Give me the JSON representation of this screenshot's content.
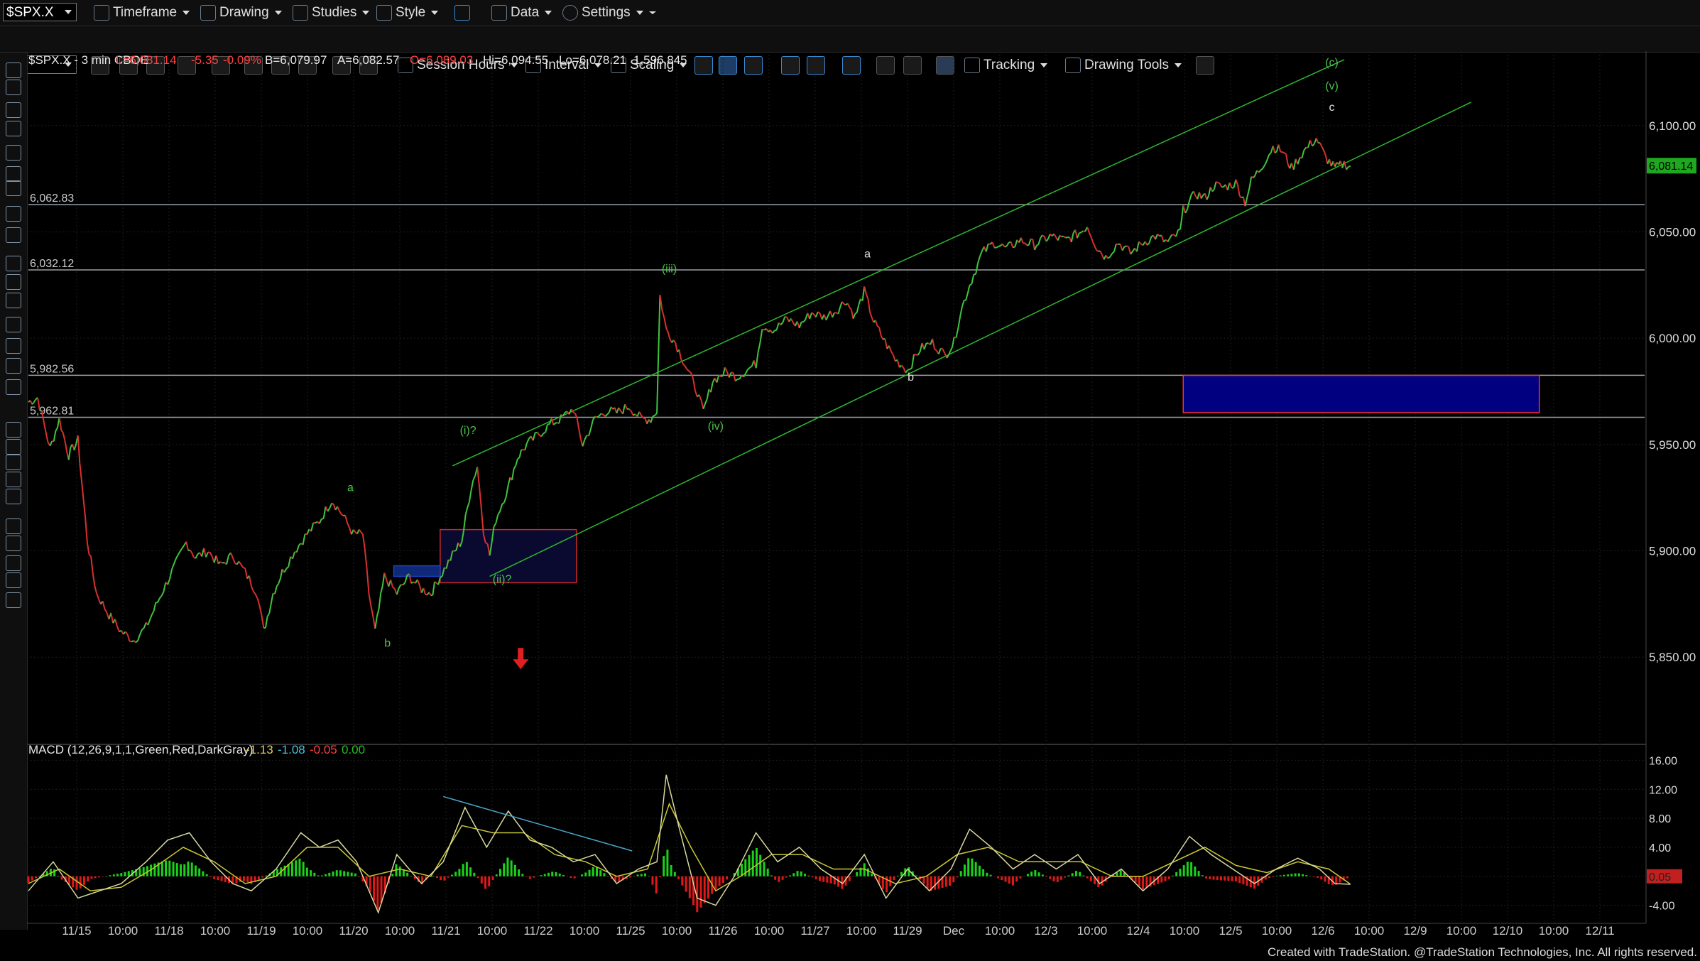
{
  "toolbar": {
    "symbol": "$SPX.X",
    "menus": [
      {
        "label": "Timeframe",
        "icon": "timeframe-icon"
      },
      {
        "label": "Drawing",
        "icon": "drawing-icon"
      },
      {
        "label": "Studies",
        "icon": "studies-icon"
      },
      {
        "label": "Style",
        "icon": "style-icon"
      },
      {
        "label": "Data",
        "icon": "data-icon"
      },
      {
        "label": "Settings",
        "icon": "gear-icon"
      }
    ],
    "row2": [
      {
        "label": "Session Hours",
        "icon": "session-hours-icon"
      },
      {
        "label": "Interval",
        "icon": "interval-icon"
      },
      {
        "label": "Scaling",
        "icon": "scaling-icon"
      },
      {
        "label": "Tracking",
        "icon": "tracking-icon"
      },
      {
        "label": "Drawing Tools",
        "icon": "drawing-tools-icon"
      }
    ]
  },
  "left_tools": [
    "cursor-icon",
    "crosshair-icon",
    "pen-icon",
    "brush-icon",
    "arrows-h-icon",
    "fib-icon",
    "channel-icon",
    "cycle-icon",
    "pencil-icon",
    "bars-icon",
    "pitchfork-icon",
    "lines-icon",
    "gann-icon",
    "dots-icon",
    "speedline-icon",
    "arc-icon",
    "arrow-down-icon",
    "arrow-up-icon",
    "ellipse-icon",
    "rectangle-icon",
    "text-icon",
    "line-icon",
    "eraser-icon",
    "ruler-icon",
    "highlighter-icon",
    "text-box-icon"
  ],
  "header": {
    "symbol_desc": "$SPX.X - 3 min  CBOE",
    "last": "L=6,081.14",
    "chg": "-5.35",
    "pct": "-0.09%",
    "bid": "B=6,079.97",
    "ask": "A=6,082.57",
    "open": "O=6,089.03",
    "hi": "Hi=6,094.55",
    "lo": "Lo=6,078.21",
    "vol": "1,596,845"
  },
  "macd_header": {
    "name": "MACD (12,26,9,1,1,Green,Red,DarkGray)",
    "v1": "-1.13",
    "v2": "-1.08",
    "v3": "-0.05",
    "v4": "0.00"
  },
  "footer": "Created with TradeStation. @TradeStation Technologies, Inc. All rights reserved.",
  "chart_data": {
    "type": "line",
    "ylim": [
      5810,
      6135
    ],
    "price_ticks": [
      "6,100.00",
      "6,050.00",
      "6,000.00",
      "5,950.00",
      "5,900.00",
      "5,850.00"
    ],
    "price_tick_values": [
      6100,
      6050,
      6000,
      5950,
      5900,
      5850
    ],
    "last_price_label": "6,081.14",
    "last_price": 6081.14,
    "horizontal_levels": [
      {
        "label": "6,062.83",
        "value": 6062.83
      },
      {
        "label": "6,032.12",
        "value": 6032.12
      },
      {
        "label": "5,982.56",
        "value": 5982.56
      },
      {
        "label": "5,962.81",
        "value": 5962.81
      }
    ],
    "x_tick_labels": [
      "11/15",
      "10:00",
      "11/18",
      "10:00",
      "11/19",
      "10:00",
      "11/20",
      "10:00",
      "11/21",
      "10:00",
      "11/22",
      "10:00",
      "11/25",
      "10:00",
      "11/26",
      "10:00",
      "11/27",
      "10:00",
      "11/29",
      "Dec",
      "10:00",
      "12/3",
      "10:00",
      "12/4",
      "10:00",
      "12/5",
      "10:00",
      "12/6",
      "10:00",
      "12/9",
      "10:00",
      "12/10",
      "10:00",
      "12/11"
    ],
    "price_path": [
      [
        0,
        5970
      ],
      [
        0.3,
        5972
      ],
      [
        0.5,
        5960
      ],
      [
        0.7,
        5948
      ],
      [
        1,
        5962
      ],
      [
        1.3,
        5945
      ],
      [
        1.6,
        5952
      ],
      [
        1.9,
        5905
      ],
      [
        2.2,
        5880
      ],
      [
        2.6,
        5870
      ],
      [
        3,
        5862
      ],
      [
        3.4,
        5858
      ],
      [
        3.8,
        5864
      ],
      [
        4.3,
        5880
      ],
      [
        4.7,
        5892
      ],
      [
        5.1,
        5904
      ],
      [
        5.4,
        5897
      ],
      [
        5.8,
        5900
      ],
      [
        6.2,
        5893
      ],
      [
        6.6,
        5898
      ],
      [
        7,
        5890
      ],
      [
        7.4,
        5880
      ],
      [
        7.6,
        5862
      ],
      [
        7.9,
        5880
      ],
      [
        8.2,
        5890
      ],
      [
        8.6,
        5900
      ],
      [
        9,
        5908
      ],
      [
        9.4,
        5914
      ],
      [
        9.8,
        5924
      ],
      [
        10.1,
        5918
      ],
      [
        10.5,
        5908
      ],
      [
        10.8,
        5908
      ],
      [
        11,
        5880
      ],
      [
        11.2,
        5862
      ],
      [
        11.5,
        5888
      ],
      [
        11.9,
        5880
      ],
      [
        12.3,
        5888
      ],
      [
        12.7,
        5882
      ],
      [
        13,
        5880
      ],
      [
        13.3,
        5888
      ],
      [
        13.7,
        5898
      ],
      [
        14,
        5905
      ],
      [
        14.3,
        5930
      ],
      [
        14.5,
        5940
      ],
      [
        14.7,
        5910
      ],
      [
        14.9,
        5898
      ],
      [
        15.1,
        5915
      ],
      [
        15.5,
        5930
      ],
      [
        15.8,
        5944
      ],
      [
        16.1,
        5950
      ],
      [
        16.5,
        5955
      ],
      [
        16.9,
        5960
      ],
      [
        17.2,
        5962
      ],
      [
        17.6,
        5967
      ],
      [
        17.9,
        5950
      ],
      [
        18.3,
        5962
      ],
      [
        18.7,
        5966
      ],
      [
        19,
        5965
      ],
      [
        19.4,
        5968
      ],
      [
        19.8,
        5962
      ],
      [
        20.1,
        5962
      ],
      [
        20.3,
        5966
      ],
      [
        20.4,
        6020
      ],
      [
        20.6,
        6004
      ],
      [
        20.9,
        5998
      ],
      [
        21.2,
        5988
      ],
      [
        21.6,
        5975
      ],
      [
        21.8,
        5965
      ],
      [
        22.1,
        5980
      ],
      [
        22.5,
        5984
      ],
      [
        22.9,
        5982
      ],
      [
        23.3,
        5986
      ],
      [
        23.5,
        5988
      ],
      [
        23.7,
        6006
      ],
      [
        24.1,
        6004
      ],
      [
        24.5,
        6009
      ],
      [
        24.9,
        6006
      ],
      [
        25.3,
        6012
      ],
      [
        25.7,
        6010
      ],
      [
        26.1,
        6013
      ],
      [
        26.4,
        6018
      ],
      [
        26.7,
        6010
      ],
      [
        27,
        6022
      ],
      [
        27.3,
        6008
      ],
      [
        27.6,
        6000
      ],
      [
        28,
        5990
      ],
      [
        28.4,
        5985
      ],
      [
        28.8,
        5995
      ],
      [
        29.2,
        5998
      ],
      [
        29.6,
        5992
      ],
      [
        29.9,
        5998
      ],
      [
        30.1,
        6012
      ],
      [
        30.4,
        6025
      ],
      [
        30.8,
        6040
      ],
      [
        31.2,
        6045
      ],
      [
        31.6,
        6042
      ],
      [
        32,
        6046
      ],
      [
        32.5,
        6044
      ],
      [
        33,
        6048
      ],
      [
        33.5,
        6046
      ],
      [
        34,
        6050
      ],
      [
        34.2,
        6053
      ],
      [
        34.5,
        6043
      ],
      [
        34.8,
        6038
      ],
      [
        35.2,
        6045
      ],
      [
        35.6,
        6040
      ],
      [
        36,
        6045
      ],
      [
        36.4,
        6048
      ],
      [
        36.8,
        6045
      ],
      [
        37.2,
        6050
      ],
      [
        37.3,
        6060
      ],
      [
        37.7,
        6068
      ],
      [
        38,
        6066
      ],
      [
        38.3,
        6072
      ],
      [
        38.6,
        6071
      ],
      [
        39,
        6073
      ],
      [
        39.3,
        6064
      ],
      [
        39.5,
        6074
      ],
      [
        39.8,
        6080
      ],
      [
        40.2,
        6090
      ],
      [
        40.5,
        6088
      ],
      [
        40.8,
        6080
      ],
      [
        41.2,
        6088
      ],
      [
        41.6,
        6094
      ],
      [
        41.9,
        6085
      ],
      [
        42.2,
        6080
      ],
      [
        42.5,
        6082
      ],
      [
        42.7,
        6081
      ]
    ],
    "channel_lines": [
      {
        "from": [
          13.7,
          5940
        ],
        "to": [
          42.5,
          6131
        ]
      },
      {
        "from": [
          14.9,
          5888
        ],
        "to": [
          46.6,
          6111
        ]
      }
    ],
    "boxes": [
      {
        "name": "blue-target-box",
        "x": [
          37.3,
          48.8
        ],
        "y": [
          5965,
          5982.5
        ],
        "fill": "#000080",
        "stroke": "#ff3030"
      },
      {
        "name": "wave-ii-box",
        "x": [
          13.3,
          17.7
        ],
        "y": [
          5885,
          5910
        ],
        "fill": "#0a0a30",
        "stroke": "#c82828"
      },
      {
        "name": "small-blue-box",
        "x": [
          11.8,
          13.3
        ],
        "y": [
          5888,
          5893
        ],
        "fill": "#102878",
        "stroke": "#2040c0"
      }
    ],
    "wave_labels": [
      {
        "text": "a",
        "x": 10.4,
        "y": 5928,
        "color": "#4cc24c"
      },
      {
        "text": "b",
        "x": 11.6,
        "y": 5855,
        "color": "#4cc24c"
      },
      {
        "text": "(i)?",
        "x": 14.2,
        "y": 5955,
        "color": "#4cc24c"
      },
      {
        "text": "(ii)?",
        "x": 15.3,
        "y": 5885,
        "color": "#4cc24c"
      },
      {
        "text": "(iii)",
        "x": 20.7,
        "y": 6031,
        "color": "#4cc24c"
      },
      {
        "text": "(iv)",
        "x": 22.2,
        "y": 5957,
        "color": "#4cc24c"
      },
      {
        "text": "a",
        "x": 27.1,
        "y": 6038,
        "color": "#e0e0e0"
      },
      {
        "text": "b",
        "x": 28.5,
        "y": 5980,
        "color": "#e0e0e0"
      },
      {
        "text": "(c)",
        "x": 42.1,
        "y": 6128,
        "color": "#4cc24c"
      },
      {
        "text": "(v)",
        "x": 42.1,
        "y": 6117,
        "color": "#4cc24c"
      },
      {
        "text": "c",
        "x": 42.1,
        "y": 6107,
        "color": "#e0e0e0"
      }
    ],
    "macd": {
      "ylim": [
        -6,
        18
      ],
      "ticks": [
        "16.00",
        "12.00",
        "8.00",
        "4.00",
        "0.05",
        "-4.00"
      ],
      "tick_values": [
        16,
        12,
        8,
        4,
        0,
        -4
      ],
      "macd_line": [
        [
          0,
          -2
        ],
        [
          0.8,
          2
        ],
        [
          1.6,
          -3
        ],
        [
          2.3,
          -2
        ],
        [
          3,
          -1
        ],
        [
          3.8,
          2
        ],
        [
          4.5,
          5
        ],
        [
          5.2,
          6
        ],
        [
          5.9,
          2
        ],
        [
          6.6,
          -1
        ],
        [
          7.2,
          -2
        ],
        [
          8,
          1
        ],
        [
          8.8,
          6
        ],
        [
          9.4,
          4
        ],
        [
          10,
          5
        ],
        [
          10.6,
          2
        ],
        [
          11.3,
          -5
        ],
        [
          11.9,
          3
        ],
        [
          12.7,
          -1
        ],
        [
          13.4,
          2
        ],
        [
          14.1,
          9.5
        ],
        [
          14.8,
          4
        ],
        [
          15.5,
          9
        ],
        [
          16.2,
          5
        ],
        [
          16.9,
          4
        ],
        [
          17.6,
          2
        ],
        [
          18.3,
          3
        ],
        [
          19,
          -1
        ],
        [
          19.7,
          1
        ],
        [
          20.3,
          2
        ],
        [
          20.6,
          14
        ],
        [
          21,
          7
        ],
        [
          21.6,
          -3
        ],
        [
          22.2,
          -4
        ],
        [
          22.8,
          0
        ],
        [
          23.5,
          6
        ],
        [
          24.2,
          2
        ],
        [
          24.9,
          4
        ],
        [
          25.6,
          1
        ],
        [
          26.3,
          -1
        ],
        [
          27,
          3
        ],
        [
          27.7,
          -3
        ],
        [
          28.4,
          1
        ],
        [
          29.1,
          -2
        ],
        [
          29.8,
          1
        ],
        [
          30.4,
          6.5
        ],
        [
          31.1,
          4
        ],
        [
          31.8,
          1
        ],
        [
          32.5,
          3
        ],
        [
          33.2,
          1
        ],
        [
          33.9,
          3
        ],
        [
          34.6,
          -1
        ],
        [
          35.3,
          1
        ],
        [
          36,
          -2
        ],
        [
          36.8,
          1
        ],
        [
          37.5,
          5.5
        ],
        [
          38.2,
          3
        ],
        [
          38.9,
          1
        ],
        [
          39.6,
          -1
        ],
        [
          40.3,
          1
        ],
        [
          41,
          2.5
        ],
        [
          41.7,
          1
        ],
        [
          42.2,
          -1
        ],
        [
          42.7,
          -1.1
        ]
      ],
      "signal_line": [
        [
          0,
          -1
        ],
        [
          1,
          1
        ],
        [
          2,
          -2
        ],
        [
          3,
          -1.5
        ],
        [
          4,
          1
        ],
        [
          5,
          4
        ],
        [
          6,
          2
        ],
        [
          7,
          -1
        ],
        [
          8,
          0
        ],
        [
          9,
          4
        ],
        [
          10,
          4
        ],
        [
          11,
          0
        ],
        [
          12,
          1
        ],
        [
          13,
          0
        ],
        [
          14,
          7
        ],
        [
          15,
          6
        ],
        [
          16,
          6
        ],
        [
          17,
          3
        ],
        [
          18,
          2
        ],
        [
          19,
          0
        ],
        [
          20,
          1
        ],
        [
          20.7,
          10
        ],
        [
          21.4,
          4
        ],
        [
          22.2,
          -2
        ],
        [
          23,
          0
        ],
        [
          24,
          3
        ],
        [
          25,
          3
        ],
        [
          26,
          1
        ],
        [
          27,
          1
        ],
        [
          28,
          -1
        ],
        [
          29,
          0
        ],
        [
          30,
          3
        ],
        [
          31,
          4
        ],
        [
          32,
          2
        ],
        [
          33,
          2
        ],
        [
          34,
          2
        ],
        [
          35,
          0
        ],
        [
          36,
          0
        ],
        [
          37,
          2
        ],
        [
          38,
          4
        ],
        [
          39,
          1.5
        ],
        [
          40,
          0.5
        ],
        [
          41,
          2
        ],
        [
          42,
          1
        ],
        [
          42.7,
          -1.08
        ]
      ],
      "divergence_line": {
        "from": [
          13.4,
          11
        ],
        "to": [
          19.5,
          3.5
        ]
      }
    },
    "sell_arrow": {
      "x": 15.9,
      "y": 5847
    }
  }
}
